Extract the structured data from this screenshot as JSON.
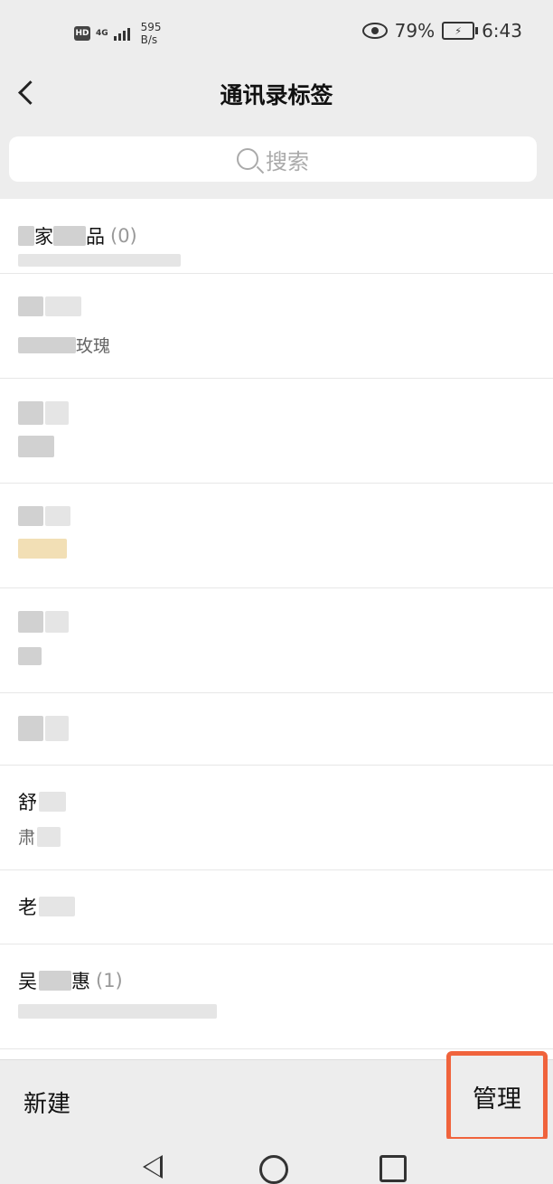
{
  "status_bar": {
    "hd": "HD",
    "network": "4G",
    "speed_value": "595",
    "speed_unit": "B/s",
    "battery_percent": "79%",
    "time": "6:43"
  },
  "header": {
    "title": "通讯录标签"
  },
  "search": {
    "placeholder": "搜索"
  },
  "tags": [
    {
      "title_visible": "家",
      "title_suffix": "品",
      "count": "(0)",
      "members_visible": ""
    },
    {
      "title_visible": "",
      "title_suffix": "",
      "count": "",
      "members_visible": "玫瑰"
    },
    {
      "title_visible": "",
      "title_suffix": "",
      "count": "",
      "members_visible": ""
    },
    {
      "title_visible": "",
      "title_suffix": "",
      "count": "",
      "members_visible": ""
    },
    {
      "title_visible": "",
      "title_suffix": "",
      "count": "",
      "members_visible": ""
    },
    {
      "title_visible": "",
      "title_suffix": "",
      "count": "",
      "members_visible": ""
    },
    {
      "title_visible": "舒",
      "title_suffix": "",
      "count": "",
      "members_visible": "肃"
    },
    {
      "title_visible": "老",
      "title_suffix": "",
      "count": "",
      "members_visible": ""
    },
    {
      "title_visible": "吴",
      "title_suffix": "惠",
      "count": "(1)",
      "members_visible": ""
    }
  ],
  "footer": {
    "new_label": "新建",
    "manage_label": "管理",
    "highlight_color": "#f0633c"
  }
}
